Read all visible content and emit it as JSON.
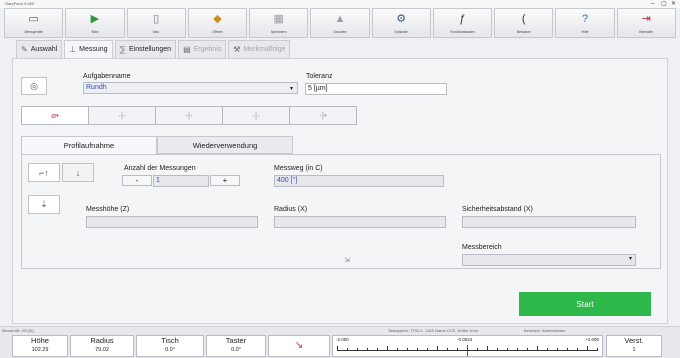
{
  "window": {
    "title": "GaryForm 9.0f/0",
    "controls": [
      "–",
      "▢",
      "✕"
    ]
  },
  "toolbar": [
    {
      "icon": "▭",
      "label": "Messgeräte",
      "color": "#556"
    },
    {
      "icon": "▶",
      "label": "Start",
      "color": "#2a9a3a"
    },
    {
      "icon": "▯",
      "label": "Neu",
      "color": "#7a7f88"
    },
    {
      "icon": "◆",
      "label": "Öffnen",
      "color": "#d08a20"
    },
    {
      "icon": "▦",
      "label": "Speichern",
      "color": "#9aa0a8"
    },
    {
      "icon": "▲",
      "label": "Drucken",
      "color": "#9aa0a8"
    },
    {
      "icon": "⚙",
      "label": "Optionen",
      "color": "#445577"
    },
    {
      "icon": "ƒ",
      "label": "Funktionstasten",
      "color": "#333"
    },
    {
      "icon": "(",
      "label": "Benutzer",
      "color": "#333"
    },
    {
      "icon": "?",
      "label": "Hilfe",
      "color": "#1a6ac0"
    },
    {
      "icon": "⇥",
      "label": "Beenden",
      "color": "#b03030"
    }
  ],
  "tabs": [
    {
      "icon": "✎",
      "label": "Auswahl"
    },
    {
      "icon": "⊥",
      "label": "Messung"
    },
    {
      "icon": "⅀",
      "label": "Einstellungen"
    },
    {
      "icon": "▤",
      "label": "Ergebnis"
    },
    {
      "icon": "⚒",
      "label": "Merkmalfolge"
    }
  ],
  "form": {
    "task_label": "Aufgabenname",
    "task_value": "Rundh",
    "tolerance_label": "Toleranz",
    "tolerance_value": "5 [µm]",
    "segments": [
      "⌀•",
      "-|-",
      "-|-",
      "-|-",
      "-|•"
    ],
    "subtabs": [
      "Profilaufnahme",
      "Wiederverwendung"
    ],
    "count_label": "Anzahl der Messungen",
    "count_value": "1",
    "count_minus": "-",
    "count_plus": "+",
    "path_label": "Messweg (in C)",
    "path_value": "400 [°]",
    "height_label": "Messhöhe (Z)",
    "radius_label": "Radius (X)",
    "safety_label": "Sicherheitsabstand (X)",
    "range_label": "Messbereich",
    "start_label": "Start"
  },
  "status": {
    "left": "Messkraft: XR-[N]",
    "mid": "Tastsystem: TTW-1 ; GAS Name CCE, Drittel 1mm",
    "right": "Benutzer: Administrator"
  },
  "readouts": [
    {
      "label": "Höhe",
      "value": "102.29"
    },
    {
      "label": "Radius",
      "value": "79.02"
    },
    {
      "label": "Tisch",
      "value": "0.0°"
    },
    {
      "label": "Taster",
      "value": "0.0°"
    }
  ],
  "scale": {
    "min": "-2.000",
    "mid": "-0.0024",
    "max": "+2.000"
  },
  "verst": {
    "label": "Verst.",
    "value": "1"
  }
}
